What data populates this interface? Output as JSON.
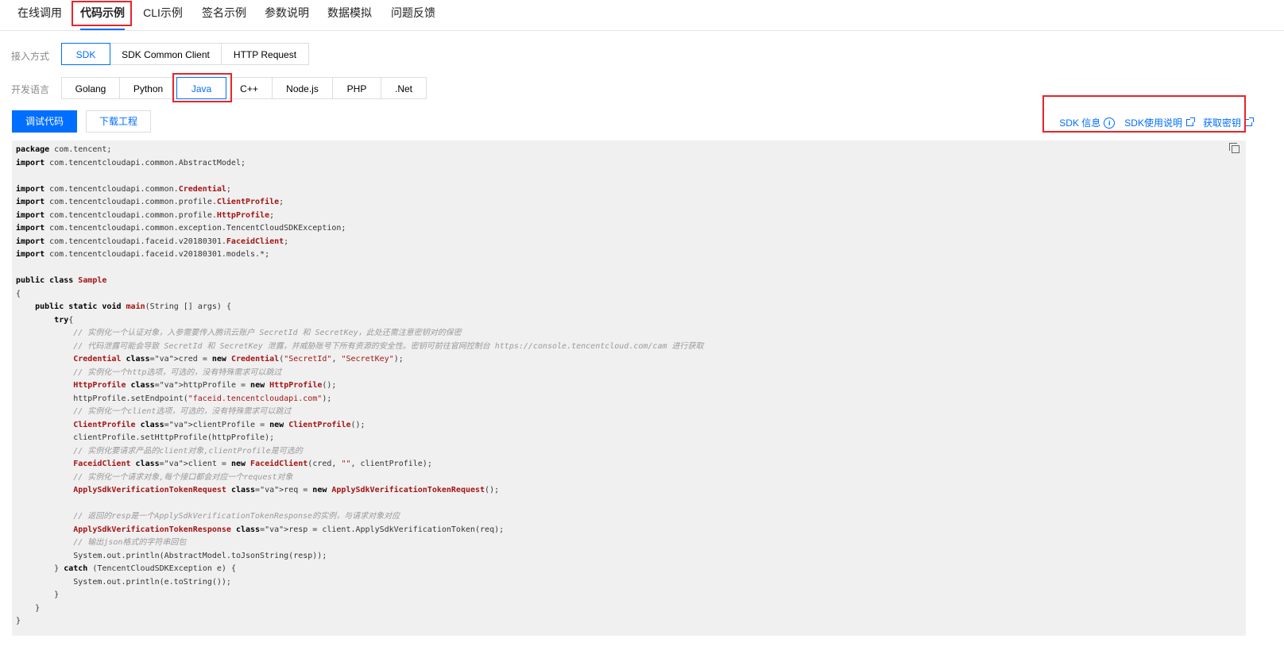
{
  "tabs": [
    "在线调用",
    "代码示例",
    "CLI示例",
    "签名示例",
    "参数说明",
    "数据模拟",
    "问题反馈"
  ],
  "active_tab": "代码示例",
  "access_label": "接入方式",
  "access_options": [
    "SDK",
    "SDK Common Client",
    "HTTP Request"
  ],
  "access_selected": "SDK",
  "lang_label": "开发语言",
  "lang_options": [
    "Golang",
    "Python",
    "Java",
    "C++",
    "Node.js",
    "PHP",
    ".Net"
  ],
  "lang_selected": "Java",
  "buttons": {
    "debug": "调试代码",
    "download": "下载工程"
  },
  "links": {
    "sdk_info": "SDK 信息",
    "sdk_usage": "SDK使用说明",
    "get_key": "获取密钥"
  },
  "accent_color": "#006eff",
  "highlight_color": "#e5262b",
  "code_lines": [
    "package com.tencent;",
    "import com.tencentcloudapi.common.AbstractModel;",
    "",
    "import com.tencentcloudapi.common.Credential;",
    "import com.tencentcloudapi.common.profile.ClientProfile;",
    "import com.tencentcloudapi.common.profile.HttpProfile;",
    "import com.tencentcloudapi.common.exception.TencentCloudSDKException;",
    "import com.tencentcloudapi.faceid.v20180301.FaceidClient;",
    "import com.tencentcloudapi.faceid.v20180301.models.*;",
    "",
    "public class Sample",
    "{",
    "    public static void main(String [] args) {",
    "        try{",
    "            // 实例化一个认证对象，入参需要传入腾讯云账户 SecretId 和 SecretKey，此处还需注意密钥对的保密",
    "            // 代码泄露可能会导致 SecretId 和 SecretKey 泄露，并威胁账号下所有资源的安全性。密钥可前往官网控制台 https://console.tencentcloud.com/cam 进行获取",
    "            Credential cred = new Credential(\"SecretId\", \"SecretKey\");",
    "            // 实例化一个http选项，可选的，没有特殊需求可以跳过",
    "            HttpProfile httpProfile = new HttpProfile();",
    "            httpProfile.setEndpoint(\"faceid.tencentcloudapi.com\");",
    "            // 实例化一个client选项，可选的，没有特殊需求可以跳过",
    "            ClientProfile clientProfile = new ClientProfile();",
    "            clientProfile.setHttpProfile(httpProfile);",
    "            // 实例化要请求产品的client对象,clientProfile是可选的",
    "            FaceidClient client = new FaceidClient(cred, \"\", clientProfile);",
    "            // 实例化一个请求对象,每个接口都会对应一个request对象",
    "            ApplySdkVerificationTokenRequest req = new ApplySdkVerificationTokenRequest();",
    "",
    "            // 返回的resp是一个ApplySdkVerificationTokenResponse的实例，与请求对象对应",
    "            ApplySdkVerificationTokenResponse resp = client.ApplySdkVerificationToken(req);",
    "            // 输出json格式的字符串回包",
    "            System.out.println(AbstractModel.toJsonString(resp));",
    "        } catch (TencentCloudSDKException e) {",
    "            System.out.println(e.toString());",
    "        }",
    "    }",
    "}"
  ]
}
